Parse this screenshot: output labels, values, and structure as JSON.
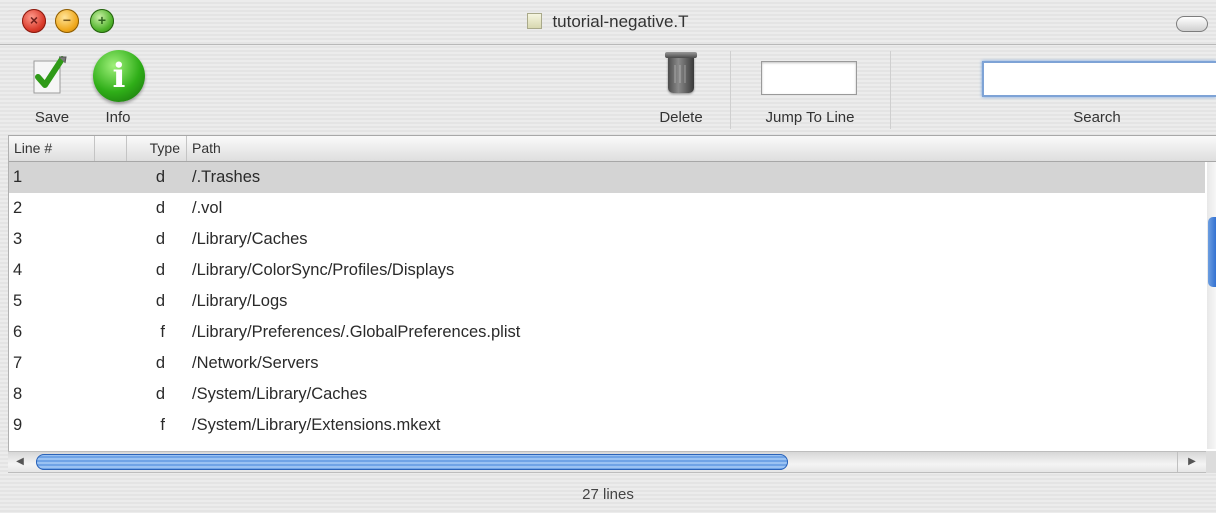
{
  "window": {
    "title": "tutorial-negative.T"
  },
  "toolbar": {
    "save_label": "Save",
    "info_label": "Info",
    "delete_label": "Delete",
    "jump_label": "Jump To Line",
    "jump_value": "",
    "search_label": "Search",
    "search_value": ""
  },
  "table": {
    "columns": [
      "Line #",
      "",
      "Type",
      "Path"
    ],
    "rows": [
      {
        "line": "1",
        "type": "d",
        "path": "/.Trashes",
        "selected": true
      },
      {
        "line": "2",
        "type": "d",
        "path": "/.vol"
      },
      {
        "line": "3",
        "type": "d",
        "path": "/Library/Caches"
      },
      {
        "line": "4",
        "type": "d",
        "path": "/Library/ColorSync/Profiles/Displays"
      },
      {
        "line": "5",
        "type": "d",
        "path": "/Library/Logs"
      },
      {
        "line": "6",
        "type": "f",
        "path": "/Library/Preferences/.GlobalPreferences.plist"
      },
      {
        "line": "7",
        "type": "d",
        "path": "/Network/Servers"
      },
      {
        "line": "8",
        "type": "d",
        "path": "/System/Library/Caches"
      },
      {
        "line": "9",
        "type": "f",
        "path": "/System/Library/Extensions.mkext"
      }
    ]
  },
  "status": {
    "text": "27 lines"
  },
  "icons": {
    "close": "close-icon",
    "minimize": "minimize-icon",
    "zoom": "zoom-icon",
    "save": "save-icon",
    "info": "info-icon",
    "delete": "trash-icon"
  },
  "colors": {
    "selection": "#d4d4d4",
    "scroll_thumb": "#6fa3e6",
    "search_focus": "#7ea3d6"
  }
}
